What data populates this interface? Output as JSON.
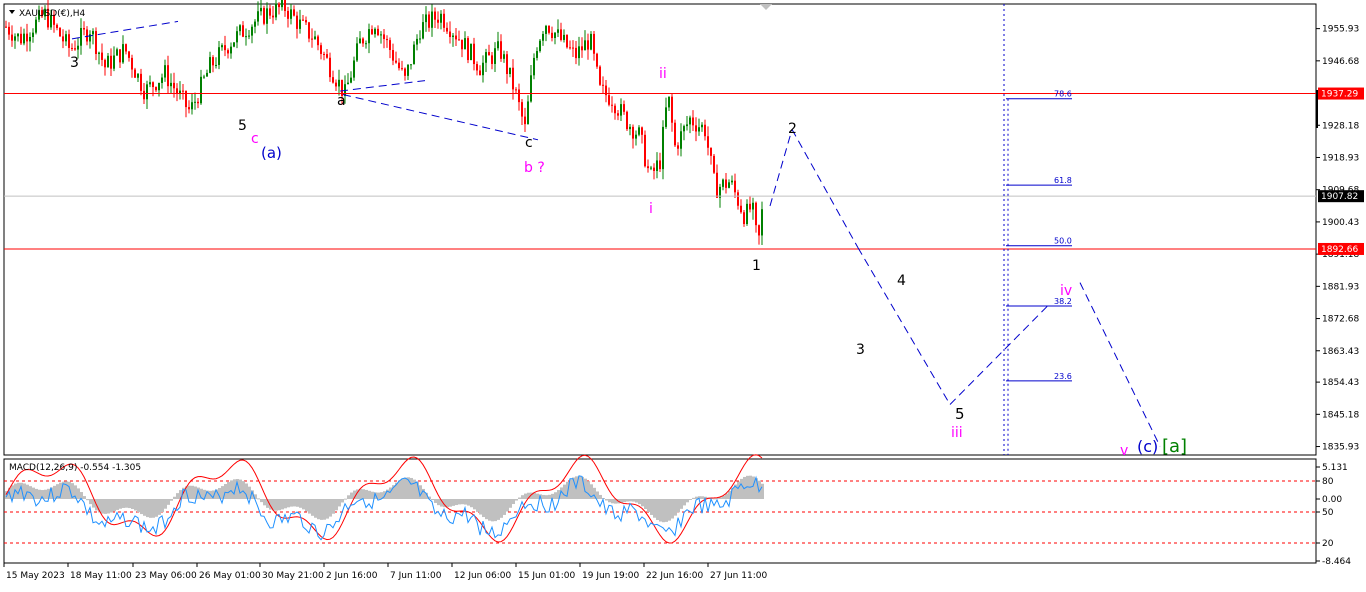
{
  "symbol_title": "XAUUSD(€),H4",
  "macd_label": "MACD(12,26,9) -0.554 -1.305",
  "price_axis": [
    {
      "label": "1955.93",
      "value": 1955.93
    },
    {
      "label": "1946.68",
      "value": 1946.68
    },
    {
      "label": "1928.18",
      "value": 1928.18
    },
    {
      "label": "1918.93",
      "value": 1918.93
    },
    {
      "label": "1909.68",
      "value": 1909.68
    },
    {
      "label": "1900.43",
      "value": 1900.43
    },
    {
      "label": "1891.18",
      "value": 1891.18
    },
    {
      "label": "1881.93",
      "value": 1881.93
    },
    {
      "label": "1872.68",
      "value": 1872.68
    },
    {
      "label": "1863.43",
      "value": 1863.43
    },
    {
      "label": "1854.43",
      "value": 1854.43
    },
    {
      "label": "1845.18",
      "value": 1845.18
    },
    {
      "label": "1835.93",
      "value": 1835.93
    }
  ],
  "price_markers": [
    {
      "label": "1937.29",
      "value": 1937.29,
      "bg": "#ff0000",
      "fg": "#ffffff"
    },
    {
      "label": "1907.82",
      "value": 1907.82,
      "bg": "#000000",
      "fg": "#ffffff"
    },
    {
      "label": "1892.66",
      "value": 1892.66,
      "bg": "#ff0000",
      "fg": "#ffffff"
    }
  ],
  "macd_axis": [
    "5.131",
    "80",
    "0.00",
    "50",
    "20",
    "-8.464"
  ],
  "time_axis": [
    "15 May 2023",
    "18 May 11:00",
    "23 May 06:00",
    "26 May 01:00",
    "30 May 21:00",
    "2 Jun 16:00",
    "7 Jun 11:00",
    "12 Jun 06:00",
    "15 Jun 01:00",
    "19 Jun 19:00",
    "22 Jun 16:00",
    "27 Jun 11:00"
  ],
  "fib_levels": [
    {
      "label": "78.6",
      "value": 1935.8
    },
    {
      "label": "61.8",
      "value": 1911.0
    },
    {
      "label": "50.0",
      "value": 1893.6
    },
    {
      "label": "38.2",
      "value": 1876.3
    },
    {
      "label": "23.6",
      "value": 1854.8
    }
  ],
  "wave_labels": [
    {
      "text": "3",
      "color": "#000000"
    },
    {
      "text": "5",
      "color": "#000000"
    },
    {
      "text": "c",
      "color": "#ff00ff"
    },
    {
      "text": "(a)",
      "color": "#0000cc"
    },
    {
      "text": "a",
      "color": "#000000"
    },
    {
      "text": "c",
      "color": "#000000"
    },
    {
      "text": "b ?",
      "color": "#ff00ff"
    },
    {
      "text": "ii",
      "color": "#ff00ff"
    },
    {
      "text": "i",
      "color": "#ff00ff"
    },
    {
      "text": "1",
      "color": "#000000"
    },
    {
      "text": "2",
      "color": "#000000"
    },
    {
      "text": "4",
      "color": "#000000"
    },
    {
      "text": "3",
      "color": "#000000"
    },
    {
      "text": "5",
      "color": "#000000"
    },
    {
      "text": "iii",
      "color": "#ff00ff"
    },
    {
      "text": "iv",
      "color": "#ff00ff"
    },
    {
      "text": "v",
      "color": "#ff00ff"
    },
    {
      "text": "(c)",
      "color": "#0000cc"
    },
    {
      "text": "[a]",
      "color": "#008000"
    }
  ],
  "colors": {
    "bull_candle": "#008000",
    "bear_candle": "#ff0000",
    "wave_line": "#0000cc",
    "horizontal_line": "#ff0000",
    "macd_histogram": "#c0c0c0",
    "macd_signal": "#ff0000",
    "stoch_line": "#1e90ff"
  },
  "chart_data": {
    "type": "candlestick",
    "title": "XAUUSD(€),H4",
    "ylim": [
      1833.5,
      1963.0
    ],
    "horizontal_lines": [
      1937.29,
      1892.66
    ],
    "current_price": 1907.82,
    "price_path": [
      {
        "x": 0,
        "close": 1958
      },
      {
        "x": 20,
        "close": 1953
      },
      {
        "x": 45,
        "close": 1960
      },
      {
        "x": 70,
        "close": 1950
      },
      {
        "x": 90,
        "close": 1956
      },
      {
        "x": 105,
        "close": 1945
      },
      {
        "x": 125,
        "close": 1950
      },
      {
        "x": 145,
        "close": 1938
      },
      {
        "x": 165,
        "close": 1943
      },
      {
        "x": 190,
        "close": 1932
      },
      {
        "x": 210,
        "close": 1945
      },
      {
        "x": 230,
        "close": 1952
      },
      {
        "x": 250,
        "close": 1957
      },
      {
        "x": 270,
        "close": 1961
      },
      {
        "x": 285,
        "close": 1962
      },
      {
        "x": 300,
        "close": 1957
      },
      {
        "x": 315,
        "close": 1953
      },
      {
        "x": 330,
        "close": 1945
      },
      {
        "x": 345,
        "close": 1937
      },
      {
        "x": 360,
        "close": 1952
      },
      {
        "x": 375,
        "close": 1958
      },
      {
        "x": 390,
        "close": 1950
      },
      {
        "x": 405,
        "close": 1941
      },
      {
        "x": 420,
        "close": 1956
      },
      {
        "x": 440,
        "close": 1960
      },
      {
        "x": 460,
        "close": 1953
      },
      {
        "x": 480,
        "close": 1945
      },
      {
        "x": 500,
        "close": 1950
      },
      {
        "x": 515,
        "close": 1938
      },
      {
        "x": 525,
        "close": 1927
      },
      {
        "x": 535,
        "close": 1950
      },
      {
        "x": 545,
        "close": 1958
      },
      {
        "x": 560,
        "close": 1953
      },
      {
        "x": 575,
        "close": 1948
      },
      {
        "x": 590,
        "close": 1953
      },
      {
        "x": 600,
        "close": 1938
      },
      {
        "x": 612,
        "close": 1936
      },
      {
        "x": 625,
        "close": 1930
      },
      {
        "x": 640,
        "close": 1925
      },
      {
        "x": 650,
        "close": 1913
      },
      {
        "x": 660,
        "close": 1918
      },
      {
        "x": 668,
        "close": 1937
      },
      {
        "x": 675,
        "close": 1922
      },
      {
        "x": 690,
        "close": 1930
      },
      {
        "x": 705,
        "close": 1927
      },
      {
        "x": 715,
        "close": 1910
      },
      {
        "x": 730,
        "close": 1912
      },
      {
        "x": 745,
        "close": 1902
      },
      {
        "x": 752,
        "close": 1905
      },
      {
        "x": 758,
        "close": 1893
      },
      {
        "x": 764,
        "close": 1908
      }
    ],
    "projection_path": [
      {
        "x": 770,
        "y": 1905
      },
      {
        "x": 792,
        "y": 1927
      },
      {
        "x": 858,
        "y": 1893
      },
      {
        "x": 895,
        "y": 1875
      },
      {
        "x": 950,
        "y": 1848
      },
      {
        "x": 1050,
        "y": 1877
      },
      {
        "x": 1080,
        "y": 1883
      },
      {
        "x": 1160,
        "y": 1836
      }
    ],
    "fibonacci": [
      {
        "label": "78.6",
        "value": 1935.8
      },
      {
        "label": "61.8",
        "value": 1911.0
      },
      {
        "label": "50.0",
        "value": 1893.6
      },
      {
        "label": "38.2",
        "value": 1876.3
      },
      {
        "label": "23.6",
        "value": 1854.8
      }
    ],
    "macd": {
      "label": "MACD(12,26,9) -0.554 -1.305",
      "main": -0.554,
      "signal": -1.305,
      "ylim": [
        -8.464,
        5.131
      ]
    }
  }
}
